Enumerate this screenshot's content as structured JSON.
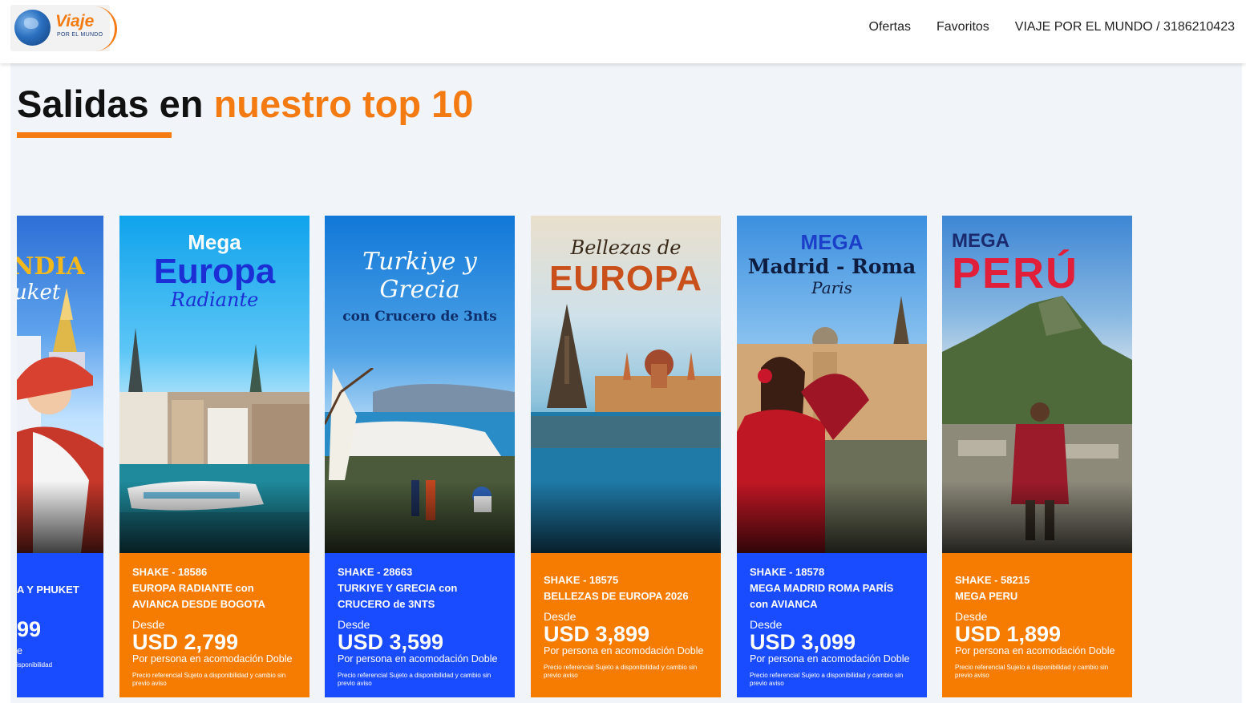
{
  "header": {
    "logo_word": "Viaje",
    "logo_sub": "POR EL MUNDO",
    "nav": [
      "Ofertas",
      "Favoritos",
      "VIAJE POR EL MUNDO / 3186210423"
    ]
  },
  "section": {
    "title_main": "Salidas en ",
    "title_accent": "nuestro top 10"
  },
  "cards": [
    {
      "poster_lines": [
        "NDIA",
        "uket"
      ],
      "code": "",
      "title": "A Y PHUKET",
      "desde": "",
      "price": "99",
      "por": "e",
      "note": "isponibilidad"
    },
    {
      "poster_lines": [
        "Mega",
        "Europa",
        "Radiante"
      ],
      "code": "SHAKE - 18586",
      "title": "EUROPA RADIANTE con AVIANCA DESDE BOGOTA",
      "desde": "Desde",
      "price": "USD 2,799",
      "por": "Por persona en acomodación Doble",
      "note": "Precio referencial Sujeto a disponibilidad y cambio sin previo aviso"
    },
    {
      "poster_lines": [
        "Turkiye y Grecia",
        "con Crucero de 3nts"
      ],
      "code": "SHAKE - 28663",
      "title": "TURKIYE Y GRECIA con CRUCERO de 3NTS",
      "desde": "Desde",
      "price": "USD 3,599",
      "por": "Por persona en acomodación Doble",
      "note": "Precio referencial Sujeto a disponibilidad y cambio sin previo aviso"
    },
    {
      "poster_lines": [
        "Bellezas de",
        "EUROPA"
      ],
      "code": "SHAKE - 18575",
      "title": "BELLEZAS DE EUROPA 2026",
      "desde": "Desde",
      "price": "USD 3,899",
      "por": "Por persona en acomodación Doble",
      "note": "Precio referencial Sujeto a disponibilidad y cambio sin previo aviso"
    },
    {
      "poster_lines": [
        "MEGA",
        "Madrid - Roma",
        "Paris"
      ],
      "code": "SHAKE - 18578",
      "title": "MEGA MADRID ROMA PARÍS con AVIANCA",
      "desde": "Desde",
      "price": "USD 3,099",
      "por": "Por persona en acomodación Doble",
      "note": "Precio referencial Sujeto a disponibilidad y cambio sin previo aviso"
    },
    {
      "poster_lines": [
        "MEGA",
        "PERÚ"
      ],
      "code": "SHAKE - 58215",
      "title": "MEGA PERU",
      "desde": "Desde",
      "price": "USD 1,899",
      "por": "Por persona en acomodación Doble",
      "note": "Precio referencial Sujeto a disponibilidad y cambio sin previo aviso"
    }
  ],
  "colors": {
    "accent_orange": "#f57c00",
    "accent_blue": "#1a4cff",
    "heading_dark": "#111111"
  }
}
